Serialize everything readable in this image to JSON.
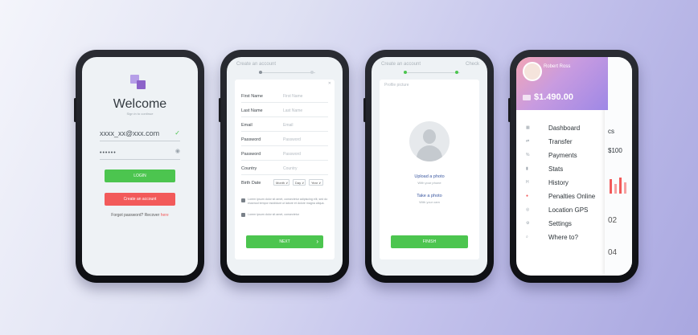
{
  "colors": {
    "green": "#4cc54f",
    "red": "#f25a5a",
    "purple": "#8c63c9",
    "lightPurple": "#b69fe8"
  },
  "phone1": {
    "title": "Welcome",
    "subtitle": "Sign in to continue",
    "email_value": "xxxx_xx@xxx.com",
    "password_value": "••••••",
    "login_label": "LOGIN",
    "create_label": "Create an account",
    "forgot_text": "Forgot password? Recover",
    "here_text": "here"
  },
  "phone2": {
    "header": "Create an account",
    "fields": [
      {
        "label": "First Name",
        "placeholder": "First Name"
      },
      {
        "label": "Last Name",
        "placeholder": "Last Name"
      },
      {
        "label": "Email",
        "placeholder": "Email"
      },
      {
        "label": "Password",
        "placeholder": "Password"
      },
      {
        "label": "Password",
        "placeholder": "Password"
      },
      {
        "label": "Country",
        "placeholder": "Country"
      }
    ],
    "birth_label": "Birth Date",
    "month": "Month",
    "day": "Day",
    "year": "Year",
    "check1": "Lorem ipsum dolor sit amet, consectetur adipiscing elit, sed do eiusmod tempor incididunt ut labore et dolore magna aliqua.",
    "check2": "Lorem ipsum dolor sit amet, consectetur",
    "next_label": "NEXT",
    "next_arrow": "›"
  },
  "phone3": {
    "header": "Create an account",
    "header_right": "Check",
    "section": "Profile picture",
    "upload": "Upload a photo",
    "upload_sub": "With your phone",
    "take": "Take a photo",
    "take_sub": "With your cam",
    "finish_label": "FINISH"
  },
  "phone4": {
    "name": "Robert Ross",
    "balance": "$1.490.00",
    "menu": [
      {
        "icon": "dashboard-icon",
        "label": "Dashboard"
      },
      {
        "icon": "transfer-icon",
        "label": "Transfer"
      },
      {
        "icon": "payments-icon",
        "label": "Payments"
      },
      {
        "icon": "stats-icon",
        "label": "Stats"
      },
      {
        "icon": "history-icon",
        "label": "History"
      },
      {
        "icon": "penalties-icon",
        "label": "Penalties Online"
      },
      {
        "icon": "location-icon",
        "label": "Location GPS"
      },
      {
        "icon": "settings-icon",
        "label": "Settings"
      },
      {
        "icon": "where-icon",
        "label": "Where to?"
      }
    ],
    "side_text1": "cs",
    "side_text2": "$100",
    "side_text3": "02",
    "side_text4": "04"
  }
}
